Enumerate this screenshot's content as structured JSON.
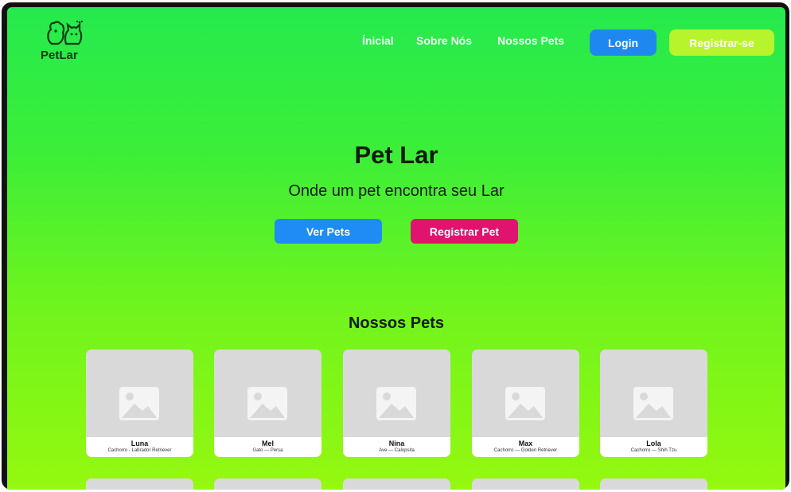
{
  "header": {
    "logo_text": "PetLar",
    "nav": [
      {
        "label": "Ínicial"
      },
      {
        "label": "Sobre Nós"
      },
      {
        "label": "Nossos Pets"
      }
    ],
    "login_label": "Login",
    "register_label": "Registrar-se"
  },
  "hero": {
    "title": "Pet Lar",
    "subtitle": "Onde um pet encontra seu Lar",
    "view_pets_label": "Ver Pets",
    "register_pet_label": "Registrar Pet"
  },
  "pets_section": {
    "title": "Nossos Pets",
    "pets": [
      {
        "name": "Luna",
        "desc": "Cachorro - Labrador Retriever"
      },
      {
        "name": "Mel",
        "desc": "Gato — Persa"
      },
      {
        "name": "Nina",
        "desc": "Ave — Calopsita"
      },
      {
        "name": "Max",
        "desc": "Cachorro — Golden Retriever"
      },
      {
        "name": "Lola",
        "desc": "Cachorro — Shih Tzu"
      }
    ]
  },
  "colors": {
    "gradient_top": "#25ea4e",
    "gradient_bottom": "#96f80f",
    "login_blue": "#1e88f0",
    "register_lime": "#b8f42c",
    "view_pets_blue": "#1e8cf4",
    "register_pet_pink": "#e0136e",
    "card_gray": "#d9d9d9"
  },
  "icons": {
    "logo": "pet-logo-icon",
    "pet_placeholder": "image-placeholder-icon"
  }
}
